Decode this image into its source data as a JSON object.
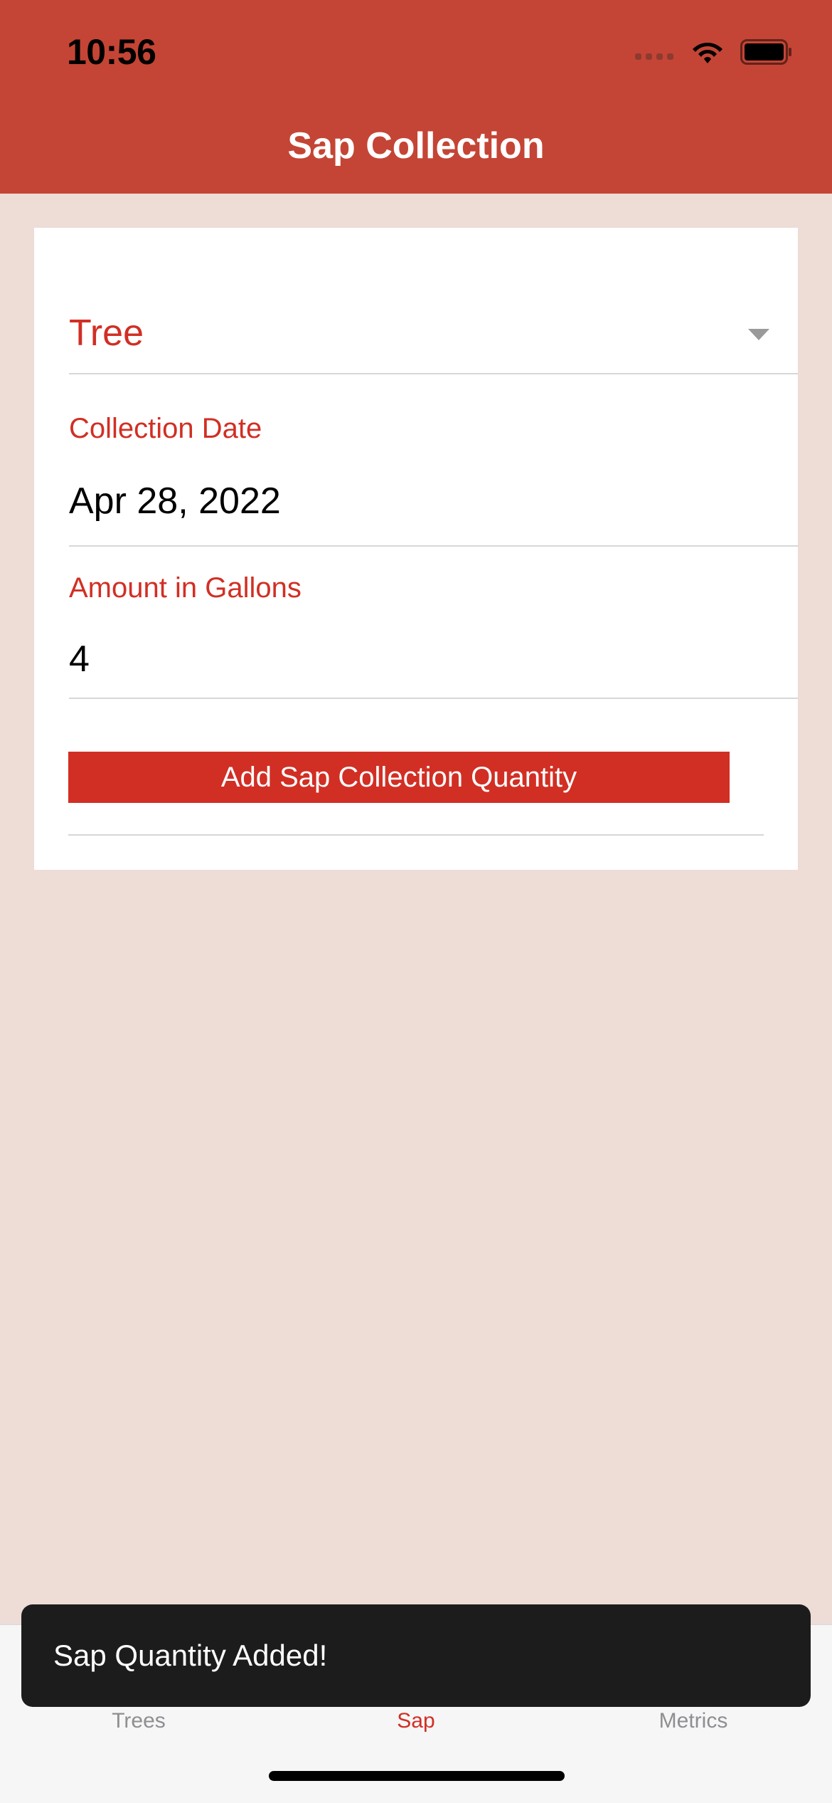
{
  "status_bar": {
    "time": "10:56"
  },
  "header": {
    "title": "Sap Collection",
    "background_color": "#C44535"
  },
  "form": {
    "tree_select": {
      "label": "Tree"
    },
    "collection_date": {
      "label": "Collection Date",
      "value": "Apr 28, 2022"
    },
    "amount": {
      "label": "Amount in Gallons",
      "value": "4"
    },
    "submit_label": "Add Sap Collection Quantity",
    "accent_color": "#D12F24"
  },
  "tabbar": {
    "items": [
      {
        "label": "Trees",
        "icon": "tree-icon",
        "active": false
      },
      {
        "label": "Sap",
        "icon": "paint-bucket-icon",
        "active": true
      },
      {
        "label": "Metrics",
        "icon": "bar-chart-icon",
        "active": false
      }
    ]
  },
  "snackbar": {
    "message": "Sap Quantity Added!"
  }
}
